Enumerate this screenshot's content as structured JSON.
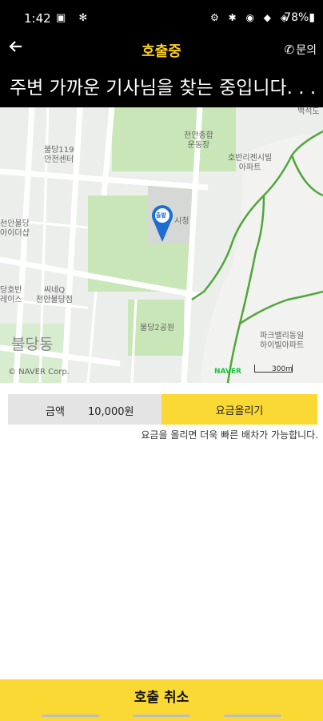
{
  "status_bar": {
    "time": "1:42",
    "left_icons": "▣ ✻",
    "right_icons": "⚙ ✱ ◉ ◆ ◈",
    "battery": "78%▮"
  },
  "header": {
    "title": "호출중",
    "inquiry_label": "문의",
    "subtitle": "주변 가까운 기사님을 찾는 중입니다. . ."
  },
  "map": {
    "labels": [
      {
        "text": "천안종합\n운동장"
      },
      {
        "text": "불당119\n안전센터"
      },
      {
        "text": "호반리젠시빌\n아파트"
      },
      {
        "text": "시청"
      },
      {
        "text": "천안불당\n아이더샵"
      },
      {
        "text": "씨네Q\n천안불당점"
      },
      {
        "text": "당호반\n레이스"
      },
      {
        "text": "불당2공원"
      },
      {
        "text": "파크밸리동일\n하이빌아파트"
      },
      {
        "text": "불당동"
      },
      {
        "text": "백석도"
      }
    ],
    "pin_label": "출발",
    "copyright": "© NAVER Corp.",
    "naver": "NAVER",
    "scale": "300m"
  },
  "fare": {
    "label": "금액",
    "value": "10,000원",
    "raise_button": "요금올리기",
    "note": "요금을 올리면 더욱 빠른 배차가 가능합니다."
  },
  "cancel_button": "호출 취소",
  "colors": {
    "accent": "#fbd934",
    "title": "#f7cc1e",
    "header_bg": "#000000"
  }
}
